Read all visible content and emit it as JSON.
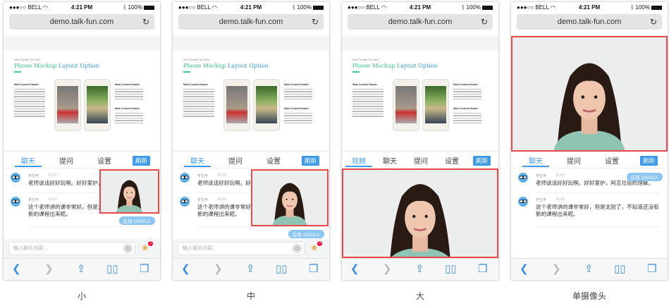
{
  "status_bar": {
    "carrier": "●●●○○ BELL",
    "time": "4:21 PM",
    "battery": "100%"
  },
  "url": "demo.talk-fun.com",
  "mockup": {
    "subtitle": "Insert Subtitle Text Here",
    "title_green": "Phone Mockup",
    "title_blue": "Layout Option",
    "header": "Main Content Header"
  },
  "chat": {
    "messages": [
      {
        "user": "学生甲",
        "time": "15:00",
        "text": "老师说话好好玩啊。好好爱护，阿吉垃圾的理解。"
      },
      {
        "user": "学生甲",
        "time": "15:00",
        "text": "这个老师讲的课非常好，但是太短了，不知道还没有新的课程出来呢。"
      }
    ],
    "online": "在线 10033人",
    "input_placeholder": "输入聊天内容...",
    "gift_badge": "3"
  },
  "tabs": {
    "video": "视频",
    "chat": "聊天",
    "ask": "提问",
    "settings": "设置",
    "refresh": "刷新"
  },
  "colors": {
    "accent": "#3d9be9",
    "video_border": "#e84a4a",
    "online_badge": "#8cc6f5"
  },
  "icons": [
    "back-icon",
    "forward-icon",
    "share-icon",
    "bookmarks-icon",
    "tabs-icon",
    "reload-icon",
    "wifi-icon",
    "bluetooth-icon",
    "battery-icon",
    "emoji-icon",
    "gift-icon"
  ],
  "phones": [
    {
      "caption": "小"
    },
    {
      "caption": "中"
    },
    {
      "caption": "大"
    },
    {
      "caption": "单摄像头"
    }
  ]
}
